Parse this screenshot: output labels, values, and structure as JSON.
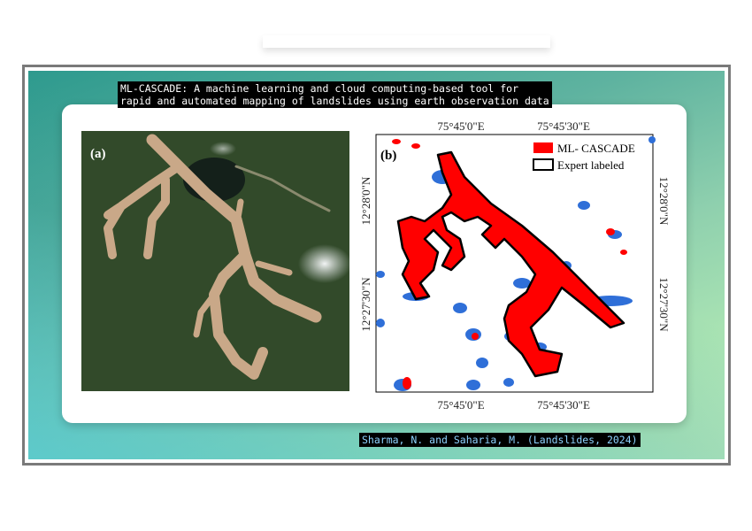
{
  "title": {
    "line1": "ML-CASCADE: A machine learning and cloud computing-based tool for",
    "line2": "rapid and automated mapping of landslides using earth observation data"
  },
  "panel_a": {
    "label": "(a)"
  },
  "panel_b": {
    "label": "(b)",
    "legend": [
      {
        "label": "ML- CASCADE",
        "color": "#ff0000"
      },
      {
        "label": "Expert labeled",
        "color": "#000000"
      }
    ],
    "x_ticks": [
      "75°45'0\"E",
      "75°45'30\"E"
    ],
    "y_ticks": [
      "12°28'0\"N",
      "12°27'30\"N"
    ],
    "colors": {
      "prediction": "#ff0000",
      "false_positive": "#2f6fd8",
      "outline": "#000000"
    }
  },
  "citation": "Sharma, N. and Saharia, M. (Landslides, 2024)"
}
